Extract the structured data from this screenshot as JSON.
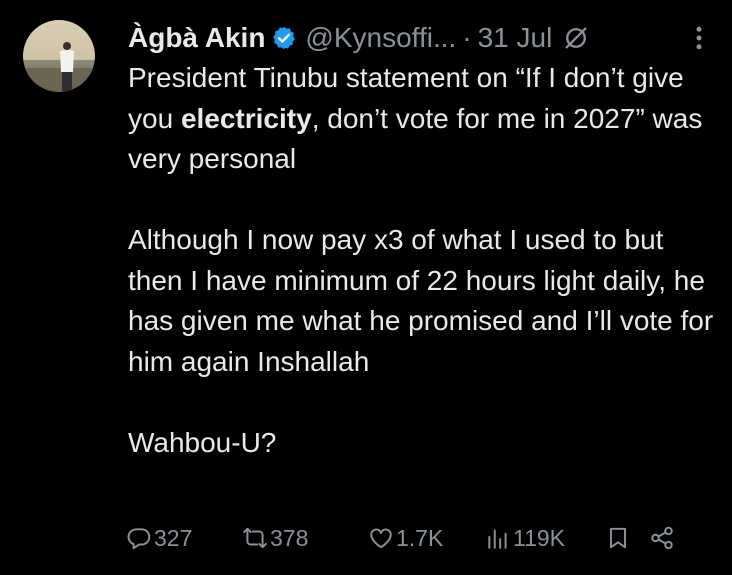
{
  "tweet": {
    "author_name": "Àgbà Akin",
    "handle": "@Kynsoffi...",
    "separator": "·",
    "timestamp": "31 Jul",
    "body": {
      "p1_pre": "President Tinubu statement on “If I don’t give you ",
      "p1_bold": "electricity",
      "p1_post": ", don’t vote for me in 2027” was very personal",
      "p2": "Although I now pay x3 of what I used to but then I have minimum of 22 hours light daily, he has given me what he promised and I’ll vote for him again Inshallah",
      "p3": "Wahbou-U?"
    },
    "stats": {
      "replies": "327",
      "reposts": "378",
      "likes": "1.7K",
      "views": "119K"
    }
  },
  "colors": {
    "background": "#000000",
    "text": "#e7e9ea",
    "muted": "#8b9198",
    "verified": "#1d9bf0"
  },
  "icons": [
    "verified-badge-icon",
    "grok-icon",
    "more-icon",
    "reply-icon",
    "repost-icon",
    "like-icon",
    "views-icon",
    "bookmark-icon",
    "share-icon"
  ]
}
